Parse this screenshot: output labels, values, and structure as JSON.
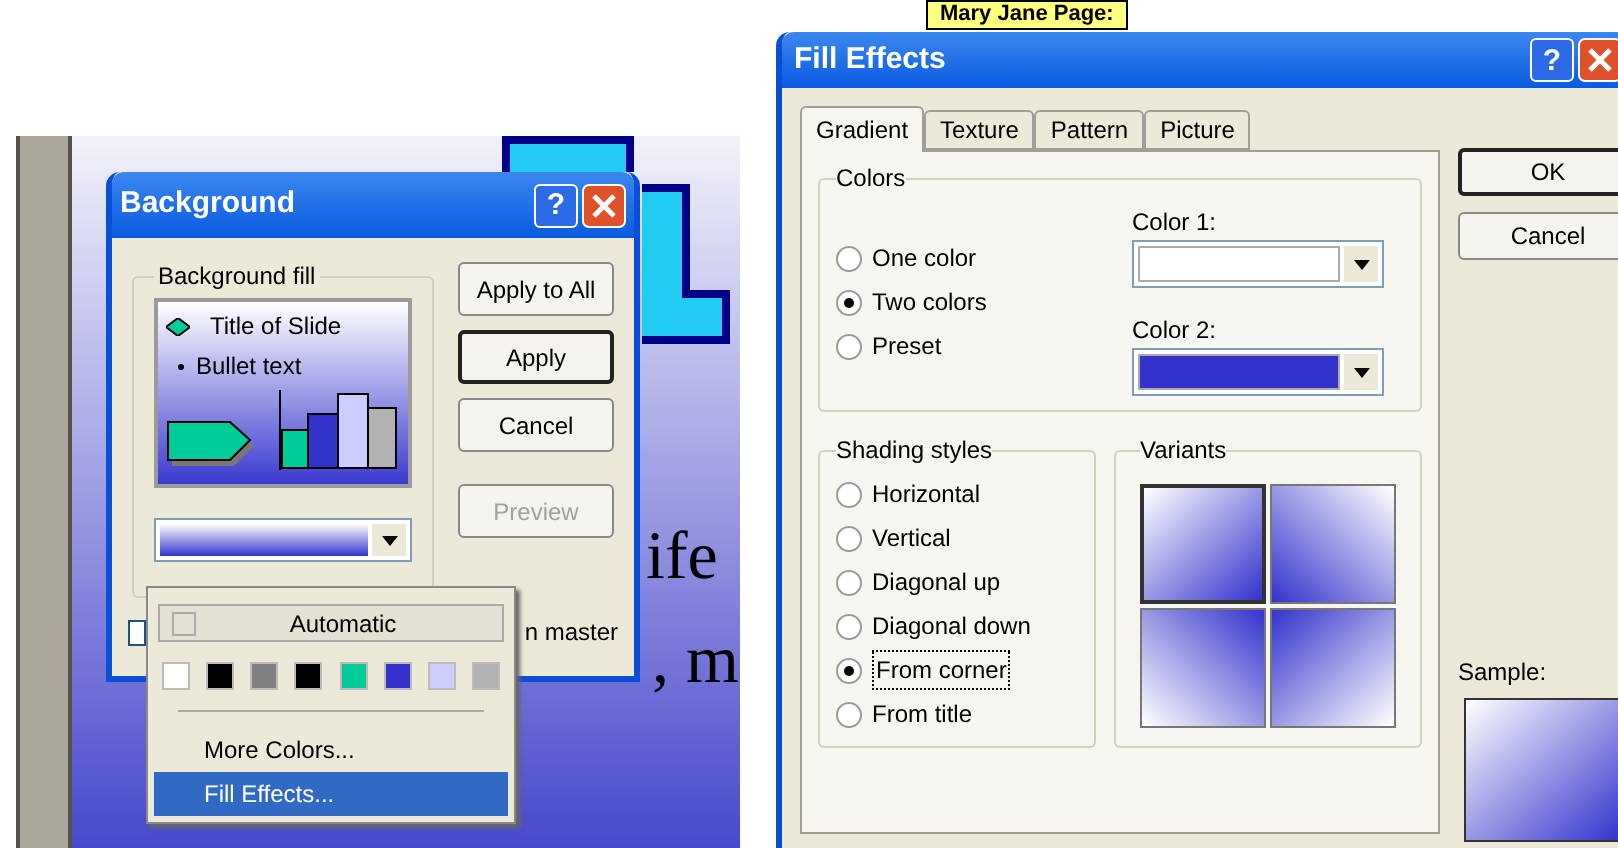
{
  "slide": {
    "texts": [
      "ife",
      ", m"
    ]
  },
  "background_dialog": {
    "title": "Background",
    "help": "?",
    "fill_group": "Background fill",
    "preview": {
      "title": "Title of Slide",
      "bullet": "Bullet text"
    },
    "buttons": [
      {
        "label": "Apply to All",
        "default": false,
        "disabled": false
      },
      {
        "label": "Apply",
        "default": true,
        "disabled": false
      },
      {
        "label": "Cancel",
        "default": false,
        "disabled": false
      },
      {
        "label": "Preview",
        "default": false,
        "disabled": true
      }
    ],
    "checkbox": {
      "label": "n master",
      "checked": false
    },
    "color_menu": {
      "automatic": "Automatic",
      "swatches": [
        {
          "color": "#ffffff"
        },
        {
          "color": "#000000"
        },
        {
          "color": "#808080"
        },
        {
          "color": "#000000"
        },
        {
          "color": "#00cc99"
        },
        {
          "color": "#3333cc"
        },
        {
          "color": "#ccccff"
        },
        {
          "color": "#b2b2b2"
        }
      ],
      "items": [
        {
          "label": "More Colors...",
          "selected": false
        },
        {
          "label": "Fill Effects...",
          "selected": true
        }
      ]
    }
  },
  "name_tag": "Mary Jane Page:",
  "fill_effects_dialog": {
    "title": "Fill Effects",
    "help": "?",
    "tabs": [
      {
        "label": "Gradient",
        "selected": true
      },
      {
        "label": "Texture",
        "selected": false
      },
      {
        "label": "Pattern",
        "selected": false
      },
      {
        "label": "Picture",
        "selected": false
      }
    ],
    "colors_group": "Colors",
    "color_options": [
      {
        "label": "One color",
        "selected": false
      },
      {
        "label": "Two colors",
        "selected": true
      },
      {
        "label": "Preset",
        "selected": false
      }
    ],
    "color1": {
      "label": "Color 1:",
      "color": "#ffffff"
    },
    "color2": {
      "label": "Color 2:",
      "color": "#3333cc"
    },
    "shading_group": "Shading styles",
    "shading": [
      {
        "label": "Horizontal",
        "selected": false
      },
      {
        "label": "Vertical",
        "selected": false
      },
      {
        "label": "Diagonal up",
        "selected": false
      },
      {
        "label": "Diagonal down",
        "selected": false
      },
      {
        "label": "From corner",
        "selected": true
      },
      {
        "label": "From title",
        "selected": false
      }
    ],
    "variants_group": "Variants",
    "variants": [
      {
        "selected": true
      },
      {
        "selected": false
      },
      {
        "selected": false
      },
      {
        "selected": false
      }
    ],
    "buttons": [
      "OK",
      "Cancel"
    ],
    "sample_label": "Sample:"
  }
}
